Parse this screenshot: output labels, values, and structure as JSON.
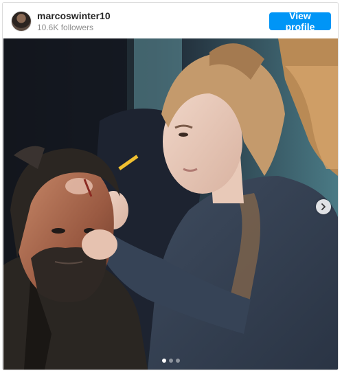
{
  "header": {
    "username": "marcoswinter10",
    "followers": "10.6K followers",
    "view_profile_label": "View profile"
  },
  "post": {
    "image_description": "",
    "carousel": {
      "total": 3,
      "active_index": 0
    }
  },
  "icons": {
    "next": "chevron-right-icon"
  },
  "colors": {
    "accent": "#0095f6",
    "border": "#dbdbdb",
    "username": "#262626",
    "secondary_text": "#8e8e8e"
  }
}
